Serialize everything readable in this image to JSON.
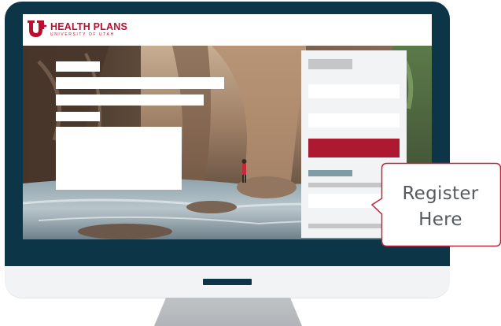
{
  "site": {
    "brand_title": "HEALTH PLANS",
    "brand_subtitle": "UNIVERSITY OF UTAH",
    "brand_color": "#be0e2d"
  },
  "form": {
    "submit_color": "#ad1930",
    "link_color": "#7e9ba6"
  },
  "monitor": {
    "bezel_color": "#0c3647"
  },
  "callout": {
    "line1": "Register",
    "line2": "Here",
    "border_color": "#c0263b"
  }
}
